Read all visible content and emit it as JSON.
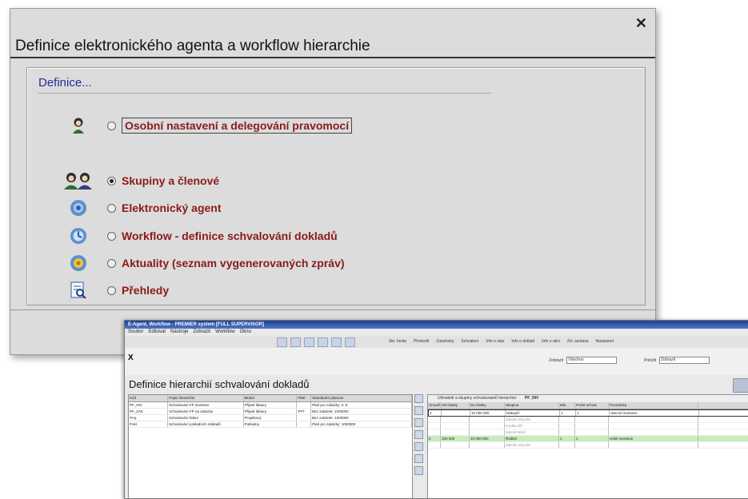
{
  "dialog": {
    "title": "Definice elektronického agenta a workflow hierarchie",
    "close_symbol": "✕",
    "legend": "Definice...",
    "options": [
      {
        "label": "Osobní nastavení a delegování pravomocí",
        "icon": "person-icon",
        "checked": false
      },
      {
        "label": "Skupiny a členové",
        "icon": "group-icon",
        "checked": true
      },
      {
        "label": "Elektronický agent",
        "icon": "agent-icon",
        "checked": false
      },
      {
        "label": "Workflow - definice schvalování dokladů",
        "icon": "workflow-icon",
        "checked": false
      },
      {
        "label": "Aktuality (seznam vygenerovaných zpráv)",
        "icon": "news-icon",
        "checked": false
      },
      {
        "label": "Přehledy",
        "icon": "report-icon",
        "checked": false
      }
    ]
  },
  "window": {
    "title": "E-Agent, Workflow - PREMIER system [FULL SUPERVISOR]",
    "menu": [
      "Soubor",
      "Editovat",
      "Nástroje",
      "Zobrazit",
      "Workflow",
      "Okno"
    ],
    "toolbar": [
      "Skr. hesla",
      "Předvolit",
      "Zaměstny",
      "Schválení",
      "Info o stav",
      "Info o doklad",
      "Info o akci",
      "Zvl. sestava",
      "Nastavení"
    ],
    "close_symbol": "X",
    "filter_label": "Zobrazit",
    "filter_value": "Všechno",
    "filter2_label": "Položit",
    "filter2_value": "Zobrazit",
    "heading": "Definice hierarchií schvalování dokladů",
    "left_grid": {
      "headers": [
        "Kód",
        "Popis hierarchie",
        "Modul",
        "Platí",
        "Standardní platnost"
      ],
      "rows": [
        [
          "PF_INV",
          "Schvalování FP investice",
          "Přijaté faktury",
          "",
          "Platí pro zakázky: 6..9"
        ],
        [
          "PF_ZAK",
          "Schvalování FP na zakázky",
          "Přijaté faktury",
          "PFT",
          "Bez zakázek: 1000000"
        ],
        [
          "Proj.",
          "Schvalování faktur",
          "Projektový",
          "",
          "Bez zakázek: 1000000"
        ],
        [
          "Pokl.",
          "Schvalování pokladních dokladů",
          "Pokladny",
          "",
          "Platí pro zakázky: 1000000"
        ]
      ]
    },
    "right_grid": {
      "caption": "Uživatelé a skupiny schvalovatelů hierarchie:",
      "caption_code": "PF_INV",
      "headers": [
        "Úroveň",
        "Od částky",
        "Do částky",
        "Skupina",
        "Min.",
        "Počet schval.",
        "Poznámka"
      ],
      "rows": [
        {
          "cells": [
            "1",
            "",
            "10 000 000",
            "Nákupčí",
            "1",
            "1",
            "obecné investice"
          ],
          "style": "sel"
        },
        {
          "cells": [
            "",
            "",
            "",
            "Zlatuše Zbyněk",
            "",
            "",
            ""
          ],
          "style": "sub"
        },
        {
          "cells": [
            "",
            "",
            "",
            "Kostka Jiří",
            "",
            "",
            ""
          ],
          "style": "sub"
        },
        {
          "cells": [
            "",
            "",
            "",
            "Mlynář Miloš",
            "",
            "",
            ""
          ],
          "style": "sub"
        },
        {
          "cells": [
            "2",
            "100 000",
            "10 000 000",
            "Ředitel",
            "1",
            "1",
            "velké investice"
          ],
          "style": "green"
        },
        {
          "cells": [
            "",
            "",
            "",
            "Zlatuše Zbyněk",
            "",
            "",
            ""
          ],
          "style": "sub"
        }
      ]
    }
  }
}
